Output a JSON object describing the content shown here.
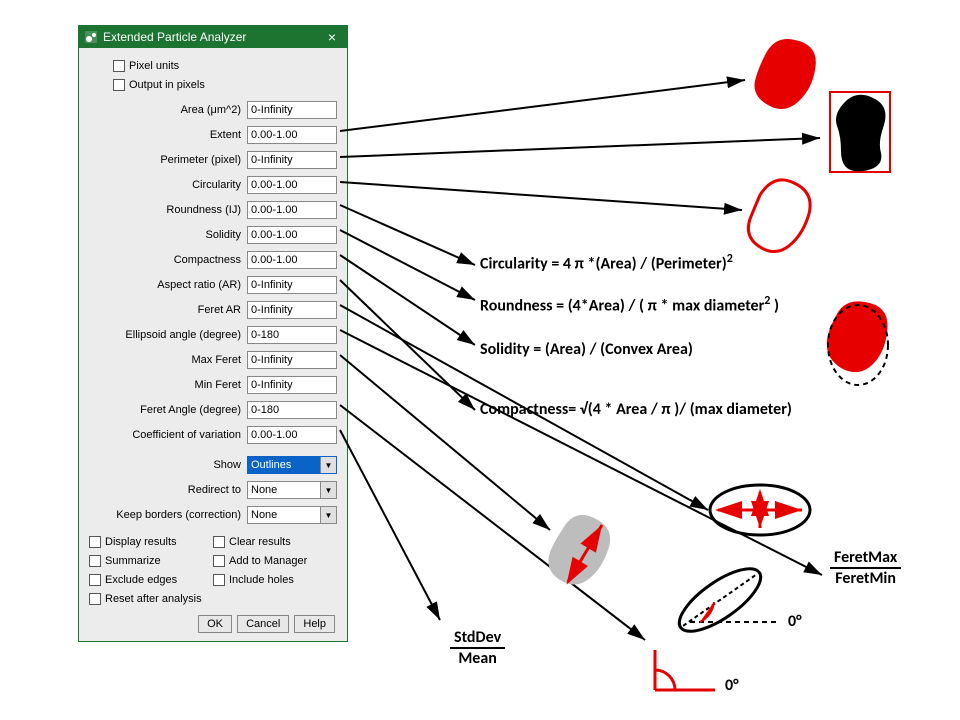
{
  "title": "Extended Particle Analyzer",
  "top_checks": [
    {
      "label": "Pixel units"
    },
    {
      "label": "Output in pixels"
    }
  ],
  "fields": [
    {
      "label": "Area (μm^2)",
      "name": "area",
      "value": "0-Infinity"
    },
    {
      "label": "Extent",
      "name": "extent",
      "value": "0.00-1.00"
    },
    {
      "label": "Perimeter (pixel)",
      "name": "perimeter",
      "value": "0-Infinity"
    },
    {
      "label": "Circularity",
      "name": "circularity",
      "value": "0.00-1.00"
    },
    {
      "label": "Roundness (IJ)",
      "name": "roundness",
      "value": "0.00-1.00"
    },
    {
      "label": "Solidity",
      "name": "solidity",
      "value": "0.00-1.00"
    },
    {
      "label": "Compactness",
      "name": "compactness",
      "value": "0.00-1.00"
    },
    {
      "label": "Aspect ratio (AR)",
      "name": "aspect-ratio",
      "value": "0-Infinity"
    },
    {
      "label": "Feret AR",
      "name": "feret-ar",
      "value": "0-Infinity"
    },
    {
      "label": "Ellipsoid angle (degree)",
      "name": "ellipsoid",
      "value": "0-180"
    },
    {
      "label": "Max Feret",
      "name": "max-feret",
      "value": "0-Infinity"
    },
    {
      "label": "Min Feret",
      "name": "min-feret",
      "value": "0-Infinity"
    },
    {
      "label": "Feret Angle (degree)",
      "name": "feret-angle",
      "value": "0-180"
    },
    {
      "label": "Coefficient of variation",
      "name": "cov",
      "value": "0.00-1.00"
    }
  ],
  "selects": [
    {
      "label": "Show",
      "name": "show",
      "value": "Outlines",
      "selected": true
    },
    {
      "label": "Redirect to",
      "name": "redirect-to",
      "value": "None",
      "selected": false
    },
    {
      "label": "Keep borders (correction)",
      "name": "keep-borders",
      "value": "None",
      "selected": false
    }
  ],
  "bottom_checks": [
    {
      "label": "Display results"
    },
    {
      "label": "Clear results"
    },
    {
      "label": "Summarize"
    },
    {
      "label": "Add to Manager"
    },
    {
      "label": "Exclude edges"
    },
    {
      "label": "Include holes"
    },
    {
      "label": "Reset after analysis"
    }
  ],
  "buttons": {
    "ok": "OK",
    "cancel": "Cancel",
    "help": "Help"
  },
  "formulas": {
    "circularity": "Circularity   =   4 π *(Area)  /  (Perimeter)",
    "roundness": "Roundness =   (4*Area) / ( π  * max diameter",
    "roundness_tail": " )",
    "solidity": "Solidity    =   (Area)  /  (Convex Area)",
    "compactness": "Compactness=   √(4 * Area / π )/ (max diameter)",
    "stddev": "StdDev",
    "mean": "Mean",
    "feretmax": "FeretMax",
    "feretmin": "FeretMin",
    "zero": "0°"
  },
  "exp2": "2"
}
